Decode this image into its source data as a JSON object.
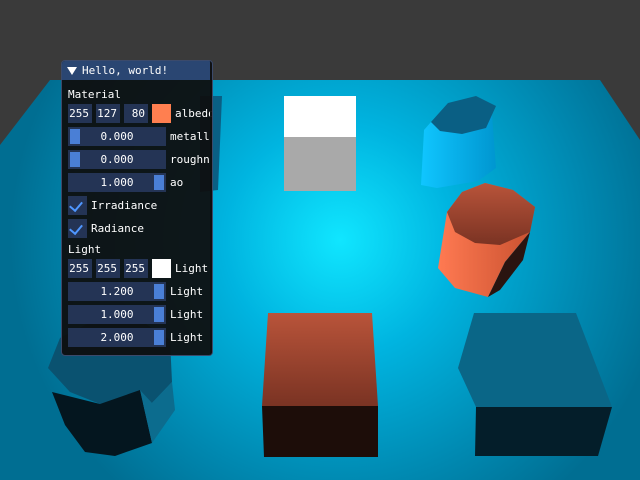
{
  "window": {
    "title": "Hello, world!"
  },
  "material": {
    "header": "Material",
    "albedo": {
      "r": "255",
      "g": "127",
      "b": "80",
      "label": "albedo",
      "color": "#ff7f50"
    },
    "metallic": {
      "value": "0.000",
      "label": "metall",
      "fraction": 0.0
    },
    "roughness": {
      "value": "0.000",
      "label": "roughn",
      "fraction": 0.0
    },
    "ao": {
      "value": "1.000",
      "label": "ao",
      "fraction": 1.0
    },
    "irradiance": {
      "label": "Irradiance",
      "checked": true
    },
    "radiance": {
      "label": "Radiance",
      "checked": true
    }
  },
  "light": {
    "header": "Light",
    "color": {
      "r": "255",
      "g": "255",
      "b": "255",
      "label": "Light",
      "color": "#ffffff"
    },
    "sliders": [
      {
        "value": "1.200",
        "label": "Light",
        "fraction": 1.0
      },
      {
        "value": "1.000",
        "label": "Light",
        "fraction": 1.0
      },
      {
        "value": "2.000",
        "label": "Light",
        "fraction": 1.0
      }
    ]
  },
  "colors": {
    "titlebar": "#2a4672",
    "frame": "#243455",
    "slider_grab": "#4a7fd6",
    "checkmark": "#4f97ff"
  }
}
